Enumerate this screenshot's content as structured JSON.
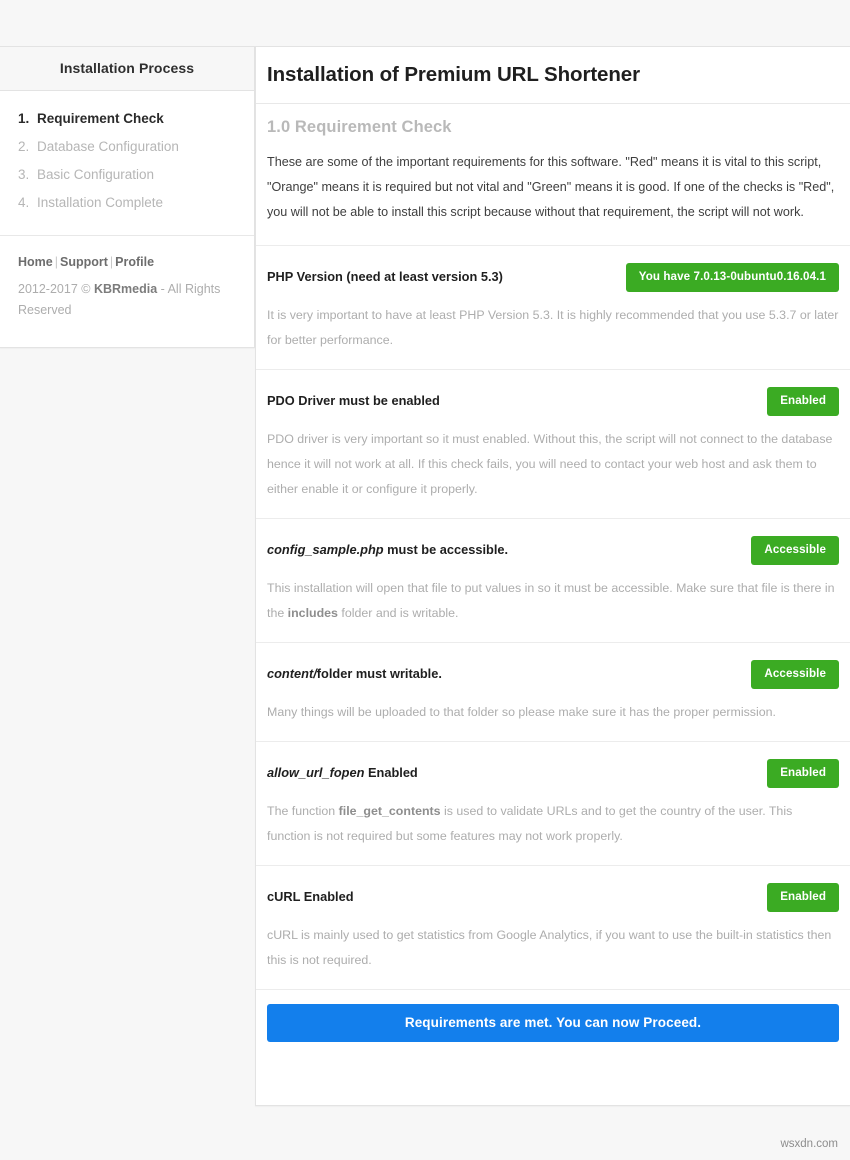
{
  "sidebar": {
    "header": "Installation Process",
    "steps": [
      {
        "num": "1.",
        "label": "Requirement Check",
        "active": true
      },
      {
        "num": "2.",
        "label": "Database Configuration",
        "active": false
      },
      {
        "num": "3.",
        "label": "Basic Configuration",
        "active": false
      },
      {
        "num": "4.",
        "label": "Installation Complete",
        "active": false
      }
    ],
    "footer": {
      "link_home": "Home",
      "link_support": "Support",
      "link_profile": "Profile",
      "separator": "|",
      "copyright_pre": "2012-2017 © ",
      "copyright_brand": "KBRmedia",
      "copyright_post": " - All Rights Reserved"
    }
  },
  "main": {
    "title": "Installation of Premium URL Shortener",
    "section_heading": "1.0 Requirement Check",
    "intro_paragraph": "These are some of the important requirements for this software. \"Red\" means it is vital to this script, \"Orange\" means it is required but not vital and \"Green\" means it is good. If one of the checks is \"Red\", you will not be able to install this script because without that requirement, the script will not work.",
    "requirements": [
      {
        "title_italic": "",
        "title": "PHP Version (need at least version 5.3)",
        "badge": "You have 7.0.13-0ubuntu0.16.04.1",
        "badge_color": "#3bab23",
        "desc_pre": "It is very important to have at least PHP Version 5.3. It is highly recommended that you use 5.3.7 or later for better performance.",
        "desc_bold": "",
        "desc_post": ""
      },
      {
        "title_italic": "",
        "title": "PDO Driver must be enabled",
        "badge": "Enabled",
        "badge_color": "#3bab23",
        "desc_pre": "PDO driver is very important so it must enabled. Without this, the script will not connect to the database hence it will not work at all. If this check fails, you will need to contact your web host and ask them to either enable it or configure it properly.",
        "desc_bold": "",
        "desc_post": ""
      },
      {
        "title_italic": "config_sample.php",
        "title": " must be accessible.",
        "badge": "Accessible",
        "badge_color": "#3bab23",
        "desc_pre": "This installation will open that file to put values in so it must be accessible. Make sure that file is there in the ",
        "desc_bold": "includes",
        "desc_post": " folder and is writable."
      },
      {
        "title_italic": "content/",
        "title": "folder must writable.",
        "badge": "Accessible",
        "badge_color": "#3bab23",
        "desc_pre": "Many things will be uploaded to that folder so please make sure it has the proper permission.",
        "desc_bold": "",
        "desc_post": ""
      },
      {
        "title_italic": "allow_url_fopen",
        "title": " Enabled",
        "badge": "Enabled",
        "badge_color": "#3bab23",
        "desc_pre": "The function ",
        "desc_bold": "file_get_contents",
        "desc_post": " is used to validate URLs and to get the country of the user. This function is not required but some features may not work properly."
      },
      {
        "title_italic": "",
        "title": "cURL Enabled",
        "badge": "Enabled",
        "badge_color": "#3bab23",
        "desc_pre": "cURL is mainly used to get statistics from Google Analytics, if you want to use the built-in statistics then this is not required.",
        "desc_bold": "",
        "desc_post": ""
      }
    ],
    "proceed_button": "Requirements are met. You can now Proceed."
  },
  "watermark": "wsxdn.com"
}
